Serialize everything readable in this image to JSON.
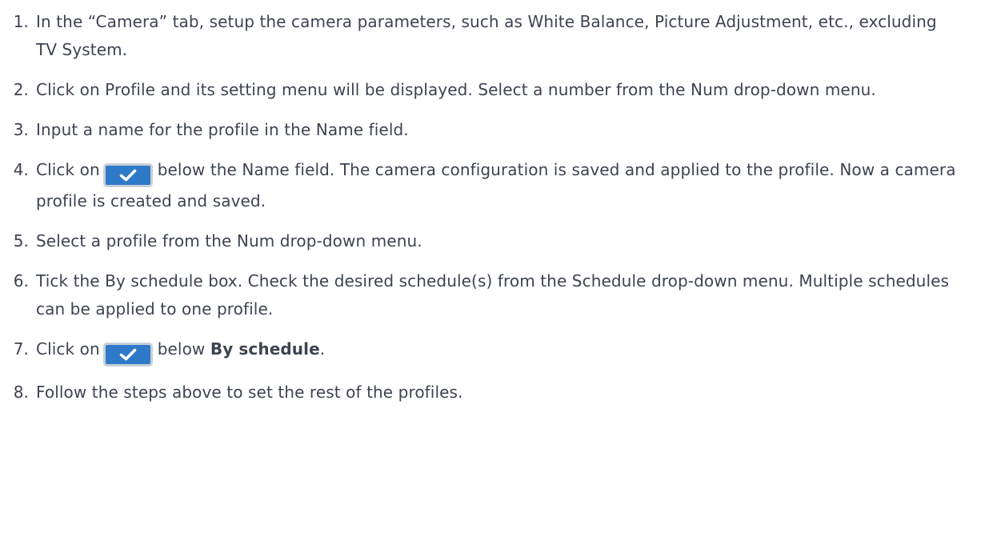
{
  "steps": [
    {
      "num": "1.",
      "text": "In the “Camera” tab, setup the camera parameters, such as White Balance, Picture Adjustment, etc., excluding TV System."
    },
    {
      "num": "2.",
      "text": "Click on Profile and its setting menu will be displayed. Select a number from the Num drop-down menu."
    },
    {
      "num": "3.",
      "text": "Input a name for the profile in the Name field."
    },
    {
      "num": "4.",
      "before": "Click on",
      "after": "below the Name field. The camera configuration is saved and applied to the profile. Now a camera profile is created and saved."
    },
    {
      "num": "5.",
      "text": "Select a profile from the Num drop-down menu."
    },
    {
      "num": "6.",
      "text": "Tick the By schedule box. Check the desired schedule(s) from the Schedule drop-down menu. Multiple schedules can be applied to one profile."
    },
    {
      "num": "7.",
      "before": "Click on",
      "mid": "below",
      "bold": "By schedule",
      "end": "."
    },
    {
      "num": "8.",
      "text": "Follow the steps above to set the rest of the profiles."
    }
  ],
  "icons": {
    "confirm_button": "check-icon",
    "button_color": "#2f79c9",
    "button_border_color": "#c8cfd8"
  }
}
